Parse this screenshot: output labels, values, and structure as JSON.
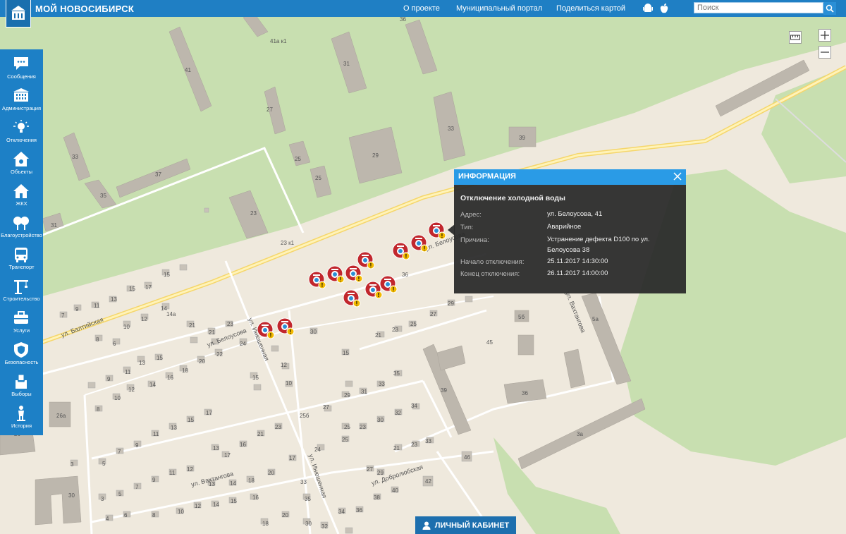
{
  "header": {
    "brand": "МОЙ НОВОСИБИРСК",
    "links": [
      "О проекте",
      "Муниципальный портал",
      "Поделиться картой"
    ],
    "search_placeholder": "Поиск",
    "icons": [
      "android-icon",
      "apple-icon",
      "search-icon"
    ]
  },
  "sidebar": {
    "items": [
      {
        "label": "Сообщения",
        "icon": "chat-icon"
      },
      {
        "label": "Администрация",
        "icon": "building-icon"
      },
      {
        "label": "Отключения",
        "icon": "lightbulb-icon"
      },
      {
        "label": "Объекты",
        "icon": "house-pin-icon"
      },
      {
        "label": "ЖКХ",
        "icon": "house-icon"
      },
      {
        "label": "Благоустройство",
        "icon": "trees-icon"
      },
      {
        "label": "Транспорт",
        "icon": "bus-icon"
      },
      {
        "label": "Строительство",
        "icon": "crane-icon"
      },
      {
        "label": "Услуги",
        "icon": "briefcase-icon"
      },
      {
        "label": "Безопасность",
        "icon": "shield-icon"
      },
      {
        "label": "Выборы",
        "icon": "ballot-icon"
      },
      {
        "label": "История",
        "icon": "monument-icon"
      }
    ]
  },
  "info": {
    "header": "ИНФОРМАЦИЯ",
    "title": "Отключение холодной воды",
    "address_label": "Адрес:",
    "address": "ул. Белоусова, 41",
    "type_label": "Тип:",
    "type": "Аварийное",
    "reason_label": "Причина:",
    "reason_line1": "Устранение дефекта D100 по ул.",
    "reason_line2": "Белоусова 38",
    "start_label": "Начало отключения:",
    "start": "25.11.2017 14:30:00",
    "end_label": "Конец отключения:",
    "end": "26.11.2017 14:00:00"
  },
  "cabinet": "ЛИЧНЫЙ КАБИНЕТ",
  "map": {
    "streets": [
      "ул. Балтийская",
      "ул. Белоусова",
      "ул. Инюшенная",
      "ул. Вахтангова",
      "ул. Добролюбская"
    ],
    "buildings": [
      "41",
      "41а к1",
      "31",
      "36",
      "27",
      "33",
      "33",
      "39",
      "29",
      "37",
      "25",
      "25",
      "35",
      "23",
      "31",
      "23 к1",
      "38",
      "15",
      "14",
      "14а",
      "13",
      "12",
      "10",
      "11",
      "9",
      "8",
      "30",
      "21",
      "23",
      "25",
      "27",
      "29",
      "45",
      "5б",
      "5а",
      "36",
      "39",
      "3а",
      "26а",
      "26",
      "30",
      "42",
      "46"
    ]
  }
}
